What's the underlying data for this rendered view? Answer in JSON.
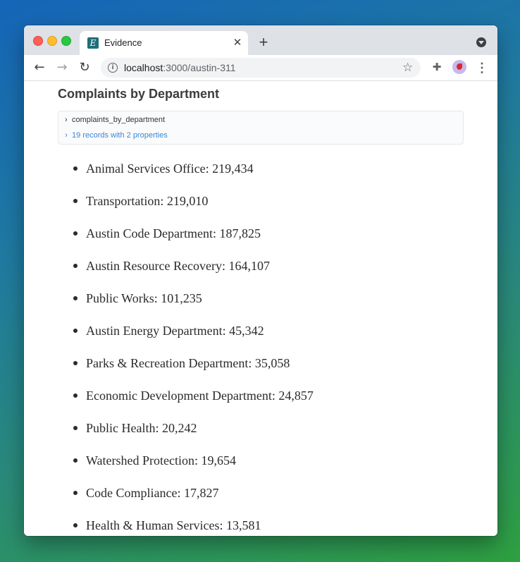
{
  "browser": {
    "tab_title": "Evidence",
    "favicon_letter": "E",
    "url_host": "localhost",
    "url_path": ":3000/austin-311"
  },
  "page": {
    "heading": "Complaints by Department",
    "query": {
      "name": "complaints_by_department",
      "summary": "19 records with 2 properties"
    },
    "departments": [
      "Animal Services Office: 219,434",
      "Transportation: 219,010",
      "Austin Code Department: 187,825",
      "Austin Resource Recovery: 164,107",
      "Public Works: 101,235",
      "Austin Energy Department: 45,342",
      "Parks & Recreation Department: 35,058",
      "Economic Development Department: 24,857",
      "Public Health: 20,242",
      "Watershed Protection: 19,654",
      "Code Compliance: 17,827",
      "Health & Human Services: 13,581"
    ]
  },
  "icons": {
    "back": "arrow-left-icon",
    "forward": "arrow-right-icon",
    "reload": "reload-icon",
    "info": "info-icon",
    "star": "star-icon",
    "extensions": "puzzle-icon",
    "menu": "kebab-menu-icon"
  },
  "colors": {
    "link_blue": "#3b87d6",
    "heading": "#3c3c3c",
    "favicon": "#1e6f78"
  }
}
